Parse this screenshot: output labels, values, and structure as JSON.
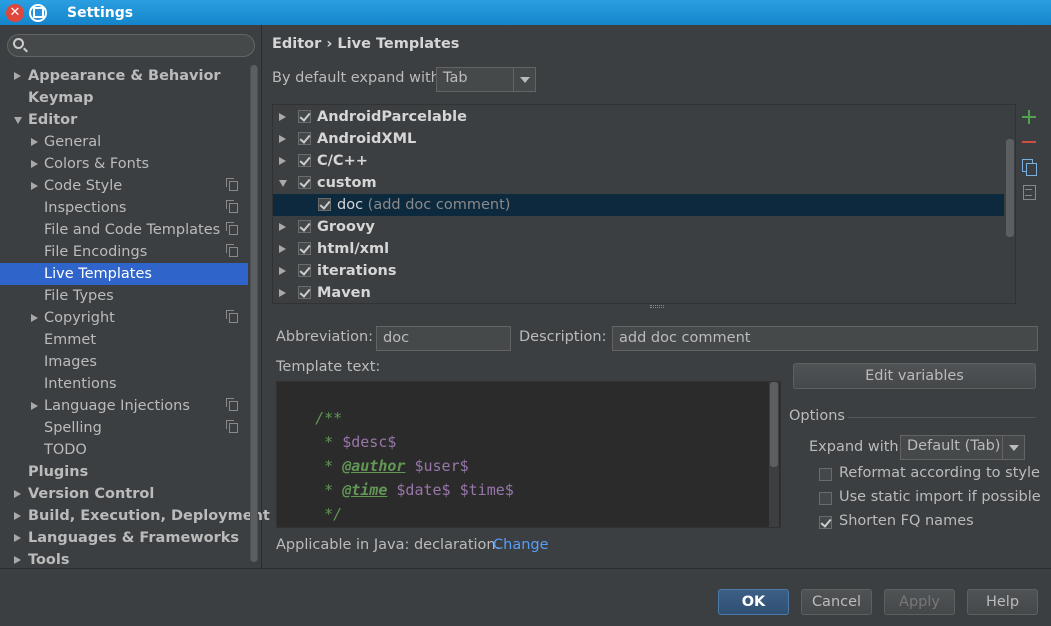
{
  "window": {
    "title": "Settings"
  },
  "search": {
    "placeholder": ""
  },
  "sidebar": {
    "items": [
      {
        "label": "Appearance & Behavior",
        "bold": true,
        "arrow": "right",
        "level": 0
      },
      {
        "label": "Keymap",
        "bold": true,
        "arrow": "",
        "level": 0
      },
      {
        "label": "Editor",
        "bold": true,
        "arrow": "down",
        "level": 0
      },
      {
        "label": "General",
        "arrow": "right",
        "level": 1
      },
      {
        "label": "Colors & Fonts",
        "arrow": "right",
        "level": 1
      },
      {
        "label": "Code Style",
        "arrow": "right",
        "level": 1,
        "project": true
      },
      {
        "label": "Inspections",
        "level": 1,
        "project": true
      },
      {
        "label": "File and Code Templates",
        "level": 1,
        "project": true
      },
      {
        "label": "File Encodings",
        "level": 1,
        "project": true
      },
      {
        "label": "Live Templates",
        "level": 1,
        "selected": true
      },
      {
        "label": "File Types",
        "level": 1
      },
      {
        "label": "Copyright",
        "arrow": "right",
        "level": 1,
        "project": true
      },
      {
        "label": "Emmet",
        "level": 1
      },
      {
        "label": "Images",
        "level": 1
      },
      {
        "label": "Intentions",
        "level": 1
      },
      {
        "label": "Language Injections",
        "arrow": "right",
        "level": 1,
        "project": true
      },
      {
        "label": "Spelling",
        "level": 1,
        "project": true
      },
      {
        "label": "TODO",
        "level": 1
      },
      {
        "label": "Plugins",
        "bold": true,
        "level": 0
      },
      {
        "label": "Version Control",
        "bold": true,
        "arrow": "right",
        "level": 0
      },
      {
        "label": "Build, Execution, Deployment",
        "bold": true,
        "arrow": "right",
        "level": 0
      },
      {
        "label": "Languages & Frameworks",
        "bold": true,
        "arrow": "right",
        "level": 0
      },
      {
        "label": "Tools",
        "bold": true,
        "arrow": "right",
        "level": 0
      }
    ]
  },
  "breadcrumb": {
    "parent": "Editor",
    "separator": "›",
    "current": "Live Templates"
  },
  "expand_default": {
    "label": "By default expand with",
    "value": "Tab"
  },
  "templates": [
    {
      "name": "AndroidParcelable",
      "checked": true,
      "arrow": "right"
    },
    {
      "name": "AndroidXML",
      "checked": true,
      "arrow": "right"
    },
    {
      "name": "C/C++",
      "checked": true,
      "arrow": "right"
    },
    {
      "name": "custom",
      "checked": true,
      "arrow": "down"
    },
    {
      "name": "doc",
      "desc": "(add doc comment)",
      "checked": true,
      "child": true,
      "selected": true
    },
    {
      "name": "Groovy",
      "checked": true,
      "arrow": "right"
    },
    {
      "name": "html/xml",
      "checked": true,
      "arrow": "right"
    },
    {
      "name": "iterations",
      "checked": true,
      "arrow": "right"
    },
    {
      "name": "Maven",
      "checked": true,
      "arrow": "right"
    }
  ],
  "detail": {
    "abbreviation_label": "Abbreviation:",
    "abbreviation_value": "doc",
    "description_label": "Description:",
    "description_value": "add doc comment",
    "template_text_label": "Template text:",
    "edit_variables": "Edit variables",
    "applicable": "Applicable in Java: declaration.",
    "change_link": "Change"
  },
  "code": {
    "l1": "/**",
    "l2_star": " * ",
    "l2_var": "$desc$",
    "l3_star": " * ",
    "l3_tag": "@author",
    "l3_var": " $user$",
    "l4_star": " * ",
    "l4_tag": "@time",
    "l4_var": " $date$ $time$",
    "l5": " */"
  },
  "options": {
    "title": "Options",
    "expand_label": "Expand with",
    "expand_value": "Default (Tab)",
    "reformat": {
      "label": "Reformat according to style",
      "checked": false
    },
    "static_import": {
      "label": "Use static import if possible",
      "checked": false
    },
    "shorten_fq": {
      "label": "Shorten FQ names",
      "checked": true
    }
  },
  "footer": {
    "ok": "OK",
    "cancel": "Cancel",
    "apply": "Apply",
    "help": "Help"
  },
  "colors": {
    "selection": "#2f65ca",
    "accent": "#589df6",
    "comment": "#629755",
    "template_var": "#9876aa"
  }
}
